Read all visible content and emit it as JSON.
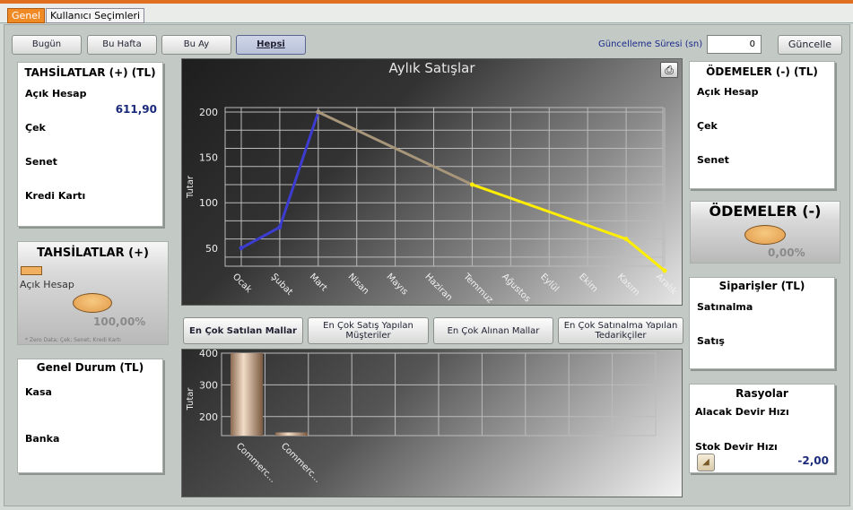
{
  "tabs": [
    "Genel",
    "Kullanıcı Seçimleri"
  ],
  "period_buttons": [
    "Bugün",
    "Bu Hafta",
    "Bu Ay",
    "Hepsi"
  ],
  "refresh": {
    "label": "Güncelleme Süresi (sn)",
    "value": "0",
    "button": "Güncelle"
  },
  "tahsilatlar_tl": {
    "title": "TAHSİLATLAR (+) (TL)",
    "rows": [
      {
        "label": "Açık Hesap",
        "value": "611,90"
      },
      {
        "label": "Çek",
        "value": ""
      },
      {
        "label": "Senet",
        "value": ""
      },
      {
        "label": "Kredi Kartı",
        "value": ""
      }
    ]
  },
  "tahsilatlar_pie": {
    "title": "TAHSİLATLAR (+)",
    "legend": "Açık Hesap",
    "percent": "100,00%",
    "note": "* Zero Data; Çek; Senet; Kredi Kartı",
    "accent": "#f0b060"
  },
  "genel_durum": {
    "title": "Genel Durum (TL)",
    "rows": [
      "Kasa",
      "Banka"
    ]
  },
  "odemeler_tl": {
    "title": "ÖDEMELER (-) (TL)",
    "rows": [
      "Açık Hesap",
      "Çek",
      "Senet"
    ]
  },
  "odemeler_pie": {
    "title": "ÖDEMELER (-)",
    "percent": "0,00%"
  },
  "siparisler": {
    "title": "Siparişler (TL)",
    "rows": [
      "Satınalma",
      "Satış"
    ]
  },
  "rasyolar": {
    "title": "Rasyolar",
    "rows": [
      "Alacak Devir Hızı",
      "Stok Devir Hızı"
    ],
    "value": "-2,00"
  },
  "chart_tabs": [
    "En Çok Satılan Mallar",
    "En Çok Satış Yapılan Müşteriler",
    "En Çok Alınan Mallar",
    "En Çok Satınalma Yapılan Tedarikçiler"
  ],
  "chart_data": [
    {
      "type": "line",
      "title": "Aylık Satışlar",
      "ylabel": "Tutar",
      "xlabel": "",
      "ylim": [
        30,
        205
      ],
      "yticks": [
        50,
        100,
        150,
        200
      ],
      "categories": [
        "Ocak",
        "Şubat",
        "Mart",
        "Nisan",
        "Mayıs",
        "Haziran",
        "Temmuz",
        "Ağustos",
        "Eylül",
        "Ekim",
        "Kasım",
        "Aralık"
      ],
      "values": [
        50,
        73,
        200,
        null,
        null,
        null,
        120,
        null,
        null,
        null,
        60,
        25
      ],
      "colors": {
        "early": "#3c3cd0",
        "mid": "#a8967a",
        "late": "#ffee00"
      }
    },
    {
      "type": "bar",
      "title": "",
      "ylabel": "Tutar",
      "ylim": [
        140,
        400
      ],
      "yticks": [
        200,
        300,
        400
      ],
      "categories": [
        "Commerc...",
        "Commerc..."
      ],
      "values": [
        400,
        150
      ]
    }
  ]
}
